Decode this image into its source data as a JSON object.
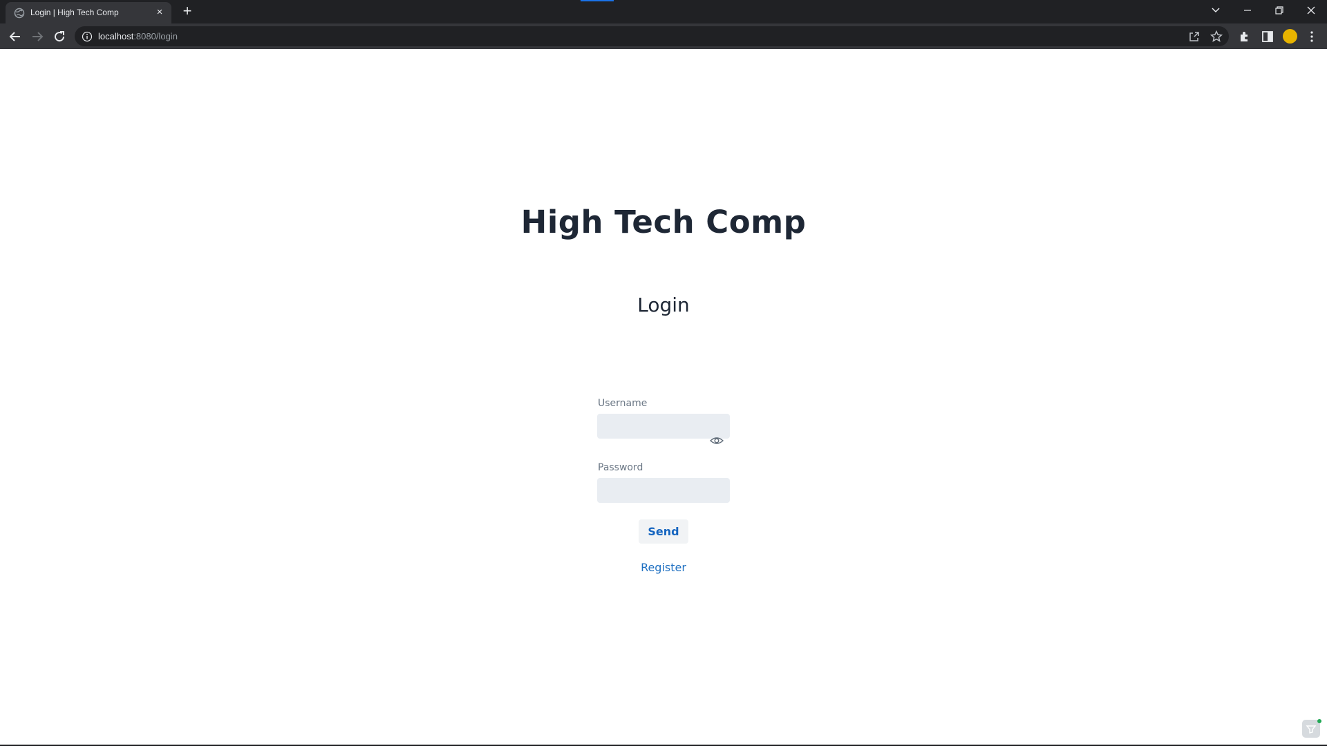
{
  "browser": {
    "tab": {
      "title": "Login | High Tech Comp",
      "close_glyph": "×"
    },
    "new_tab_glyph": "+",
    "url": {
      "host": "localhost",
      "rest": ":8080/login"
    },
    "window_controls": [
      "chevron-down",
      "minimize",
      "restore",
      "close"
    ]
  },
  "page": {
    "site_title": "High Tech Comp",
    "form": {
      "heading": "Login",
      "username_label": "Username",
      "username_value": "",
      "password_label": "Password",
      "password_value": "",
      "submit_label": "Send",
      "register_label": "Register"
    }
  },
  "colors": {
    "chrome_dark": "#202124",
    "chrome_toolbar": "#35363a",
    "title_text": "#1e2735",
    "input_bg": "#e9edf2",
    "link_blue": "#1e6fc1",
    "button_text": "#1565c0"
  }
}
